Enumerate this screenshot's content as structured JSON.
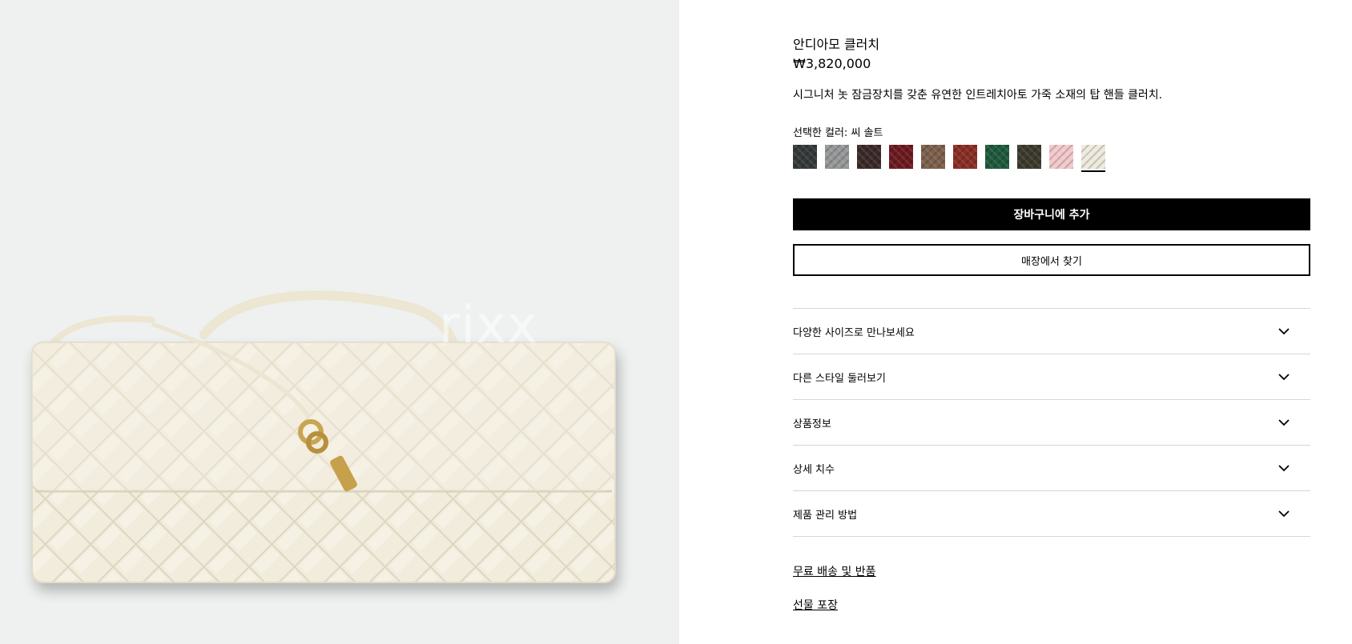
{
  "product": {
    "title": "안디아모 클러치",
    "price": "₩3,820,000",
    "description": "시그니처 놋 잠금장치를 갖춘 유연한 인트레치아토 가죽 소재의 탑 핸들 클러치.",
    "selected_color_label": "선택한 컬러: 씨 솔트",
    "image_watermark": "rixx"
  },
  "swatches": [
    {
      "name": "black",
      "color": "#34393a"
    },
    {
      "name": "grey",
      "color": "#959798"
    },
    {
      "name": "fondant",
      "color": "#3b2a28"
    },
    {
      "name": "barolo",
      "color": "#6c1a20"
    },
    {
      "name": "taupe",
      "color": "#7d604c"
    },
    {
      "name": "red",
      "color": "#8a2d24"
    },
    {
      "name": "emerald",
      "color": "#1e5a3c"
    },
    {
      "name": "olive",
      "color": "#3c3a2c"
    },
    {
      "name": "pink",
      "color": "#f2c9cb"
    },
    {
      "name": "sea-salt",
      "color": "#eeeadd",
      "selected": true
    }
  ],
  "buttons": {
    "add_to_cart": "장바구니에 추가",
    "find_in_store": "매장에서 찾기"
  },
  "accordion": [
    "다양한 사이즈로 만나보세요",
    "다른 스타일 둘러보기",
    "상품정보",
    "상세 치수",
    "제품 관리 방법"
  ],
  "links": {
    "shipping": "무료 배송 및 반품",
    "gift": "선물 포장"
  }
}
